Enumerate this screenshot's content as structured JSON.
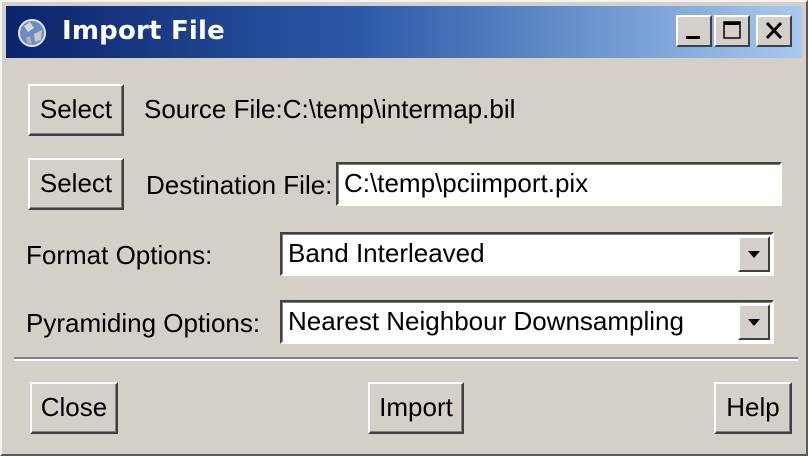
{
  "window": {
    "title": "Import File",
    "title_bar_colors": {
      "start": "#0a246a",
      "end": "#a6caf0"
    },
    "controls": {
      "minimize": "minimize-icon",
      "maximize": "maximize-icon",
      "close": "close-icon"
    }
  },
  "source": {
    "button_label": "Select",
    "label": "Source File:",
    "path": "C:\\temp\\intermap.bil"
  },
  "destination": {
    "button_label": "Select",
    "label": "Destination File:",
    "value": "C:\\temp\\pciimport.pix"
  },
  "format": {
    "label": "Format Options:",
    "selected": "Band Interleaved"
  },
  "pyramiding": {
    "label": "Pyramiding Options:",
    "selected": "Nearest Neighbour Downsampling"
  },
  "footer": {
    "close_label": "Close",
    "import_label": "Import",
    "help_label": "Help"
  }
}
